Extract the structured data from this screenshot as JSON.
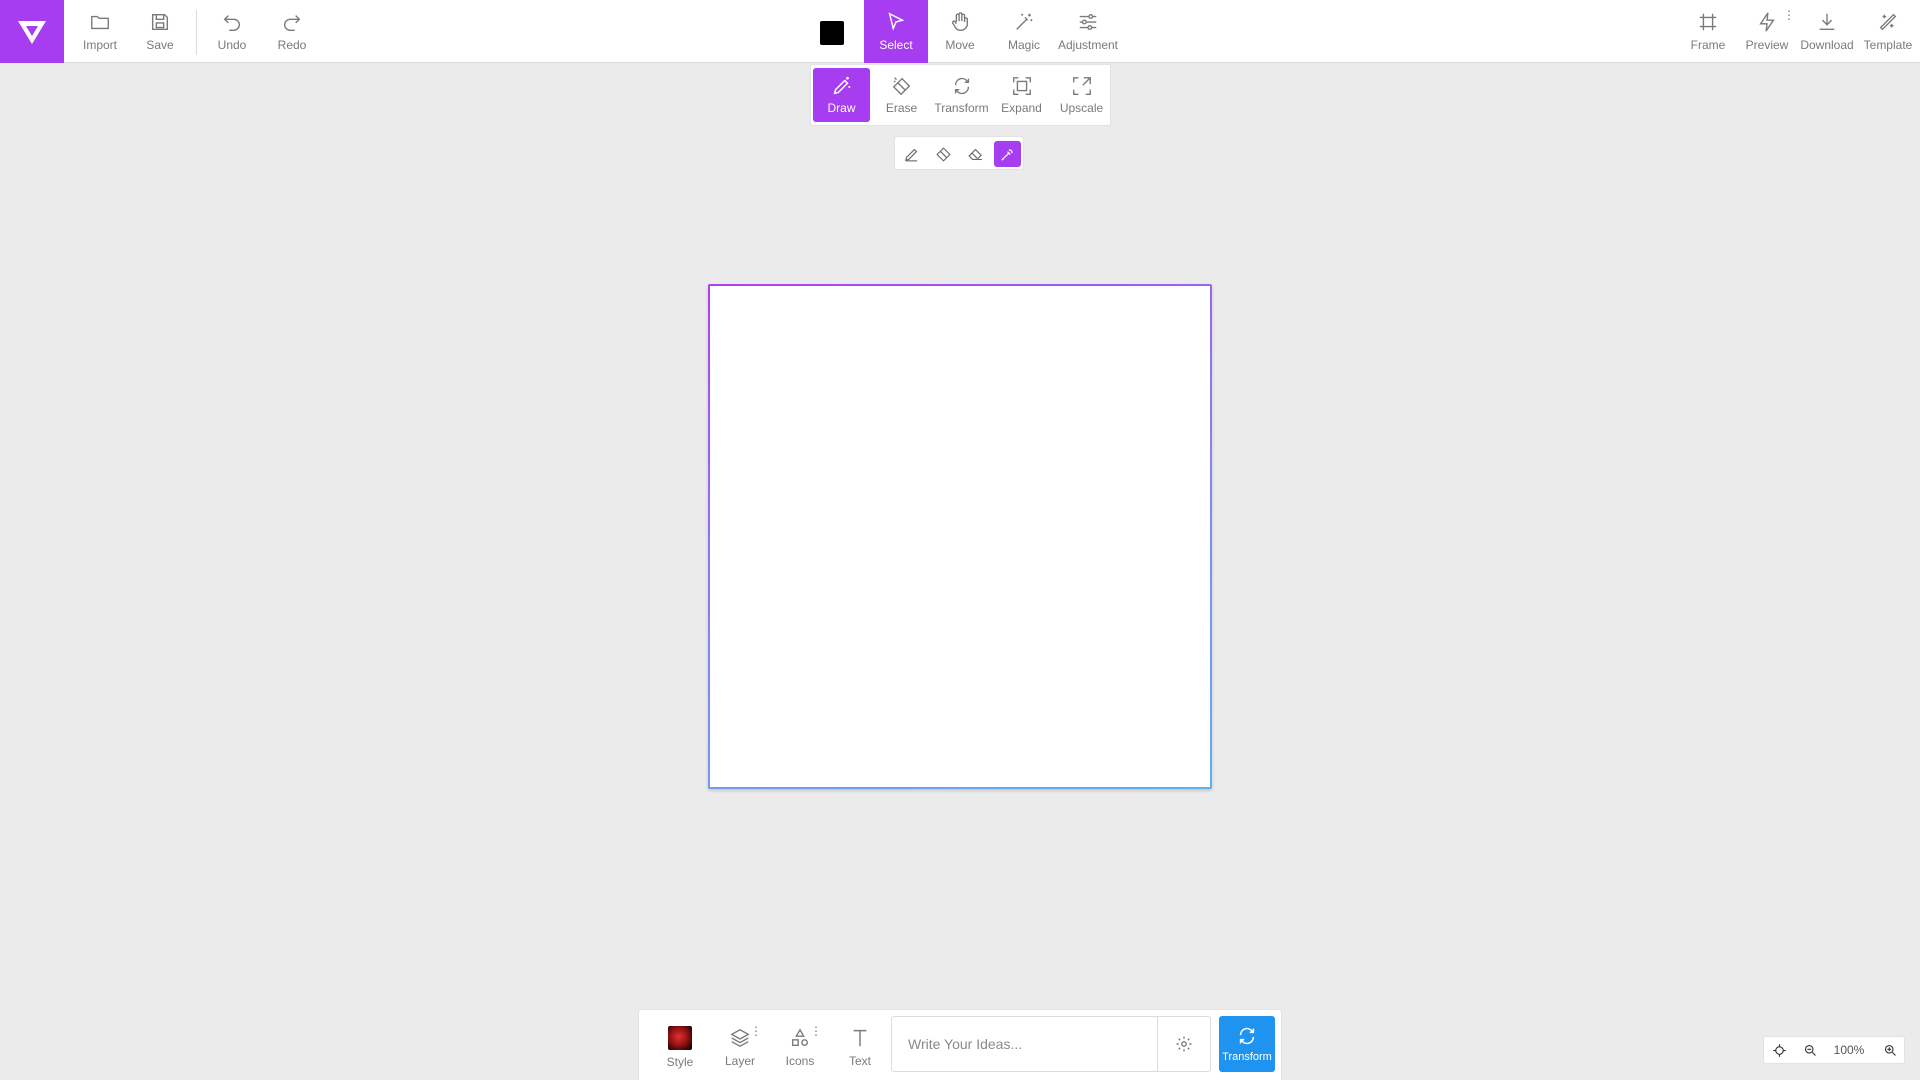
{
  "app": {
    "logo_icon": "v-logo-icon",
    "accent_color": "#a63df0",
    "primary_button_color": "#1f93f0"
  },
  "toolbar": {
    "left": [
      {
        "id": "import",
        "label": "Import",
        "icon": "folder-icon"
      },
      {
        "id": "save",
        "label": "Save",
        "icon": "save-icon"
      },
      {
        "id": "undo",
        "label": "Undo",
        "icon": "undo-icon"
      },
      {
        "id": "redo",
        "label": "Redo",
        "icon": "redo-icon"
      }
    ],
    "current_color": "#000000",
    "center": [
      {
        "id": "select",
        "label": "Select",
        "icon": "cursor-icon",
        "active": true
      },
      {
        "id": "move",
        "label": "Move",
        "icon": "hand-icon"
      },
      {
        "id": "magic",
        "label": "Magic",
        "icon": "magic-wand-icon"
      },
      {
        "id": "adjustment",
        "label": "Adjustment",
        "icon": "sliders-icon"
      }
    ],
    "right": [
      {
        "id": "frame",
        "label": "Frame",
        "icon": "frame-icon"
      },
      {
        "id": "preview",
        "label": "Preview",
        "icon": "lightning-icon"
      },
      {
        "id": "download",
        "label": "Download",
        "icon": "download-icon"
      },
      {
        "id": "template",
        "label": "Template",
        "icon": "template-icon"
      }
    ]
  },
  "subtoolbar": [
    {
      "id": "draw",
      "label": "Draw",
      "icon": "pencil-sparkle-icon",
      "active": true
    },
    {
      "id": "erase",
      "label": "Erase",
      "icon": "eraser-icon"
    },
    {
      "id": "transform",
      "label": "Transform",
      "icon": "transform-icon"
    },
    {
      "id": "expand",
      "label": "Expand",
      "icon": "expand-icon"
    },
    {
      "id": "upscale",
      "label": "Upscale",
      "icon": "upscale-icon"
    }
  ],
  "brushbar": [
    {
      "id": "pencil",
      "icon": "pencil-icon"
    },
    {
      "id": "eraser",
      "icon": "eraser-icon"
    },
    {
      "id": "eraser-alt",
      "icon": "eraser-alt-icon"
    },
    {
      "id": "eyedropper",
      "icon": "eyedropper-icon",
      "active": true
    }
  ],
  "bottombar": {
    "buttons": [
      {
        "id": "style",
        "label": "Style",
        "icon": "style-thumbnail"
      },
      {
        "id": "layer",
        "label": "Layer",
        "icon": "layers-icon"
      },
      {
        "id": "icons",
        "label": "Icons",
        "icon": "shapes-icon"
      },
      {
        "id": "text",
        "label": "Text",
        "icon": "text-icon"
      }
    ],
    "prompt_placeholder": "Write Your Ideas...",
    "prompt_value": "",
    "transform_label": "Transform"
  },
  "zoom": {
    "level": "100%"
  }
}
